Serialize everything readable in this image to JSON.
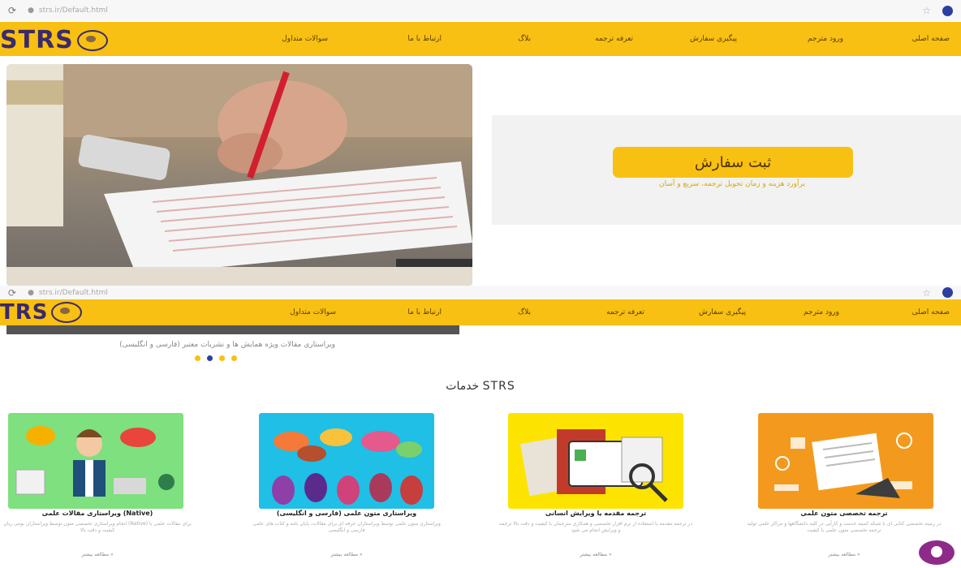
{
  "browser": {
    "address": "strs.ir/Default.html",
    "address_second": "strs.ir/Default.html"
  },
  "logo": {
    "text": "STRS",
    "text_second": "TRS"
  },
  "menu": [
    {
      "label": "صفحه اصلی"
    },
    {
      "label": "ورود مترجم"
    },
    {
      "label": "پیگیری سفارش"
    },
    {
      "label": "تعرفه ترجمه"
    },
    {
      "label": "بلاگ"
    },
    {
      "label": "ارتباط با ما"
    },
    {
      "label": "سوالات متداول"
    }
  ],
  "hero": {
    "cta_label": "ثبت سفارش",
    "cta_subtitle": "برآورد هزینه و زمان تحویل ترجمه، سریع و آسان"
  },
  "slider": {
    "caption": "ویراستاری مقالات ویژه همایش ها و نشریات معتبر (فارسی و انگلیسی)"
  },
  "services": {
    "title": "خدمات STRS",
    "cards": [
      {
        "title": "ترجمه تخصصی متون علمی",
        "desc": "در زمینه تخصصی کتابی ای با شبکه کمیته خدمت و کارآیی در کلیه دانشگاهها و مراکز علمی تولید ترجمه تخصصی متون علمی با کیفیت",
        "more": "مطالعه بیشتر »"
      },
      {
        "title": "ترجمه مقدمه یا ویرایش انسانی",
        "desc": "در ترجمه مقدمه با استفاده از نرم افزار تخصصی و همکاری مترجمان با کیفیت و دقت بالا ترجمه و ویرایش انجام می شود",
        "more": "مطالعه بیشتر »"
      },
      {
        "title": "ویراستاری متون علمی (فارسی و انگلیسی)",
        "desc": "ویراستاری متون علمی توسط ویراستاران حرفه ای برای مقالات، پایان نامه و کتاب های علمی فارسی و انگلیسی",
        "more": "مطالعه بیشتر »"
      },
      {
        "title": "ویراستاری مقالات علمی (Native)",
        "desc": "انجام ویراستاری تخصصی متون توسط ویراستاران بومی زبان (Native) برای مقالات علمی با کیفیت و دقت بالا",
        "more": "مطالعه بیشتر »"
      }
    ]
  },
  "colors": {
    "brand_yellow": "#f8c012",
    "brand_purple": "#3a2a6b",
    "chat_purple": "#8e2a8a"
  }
}
